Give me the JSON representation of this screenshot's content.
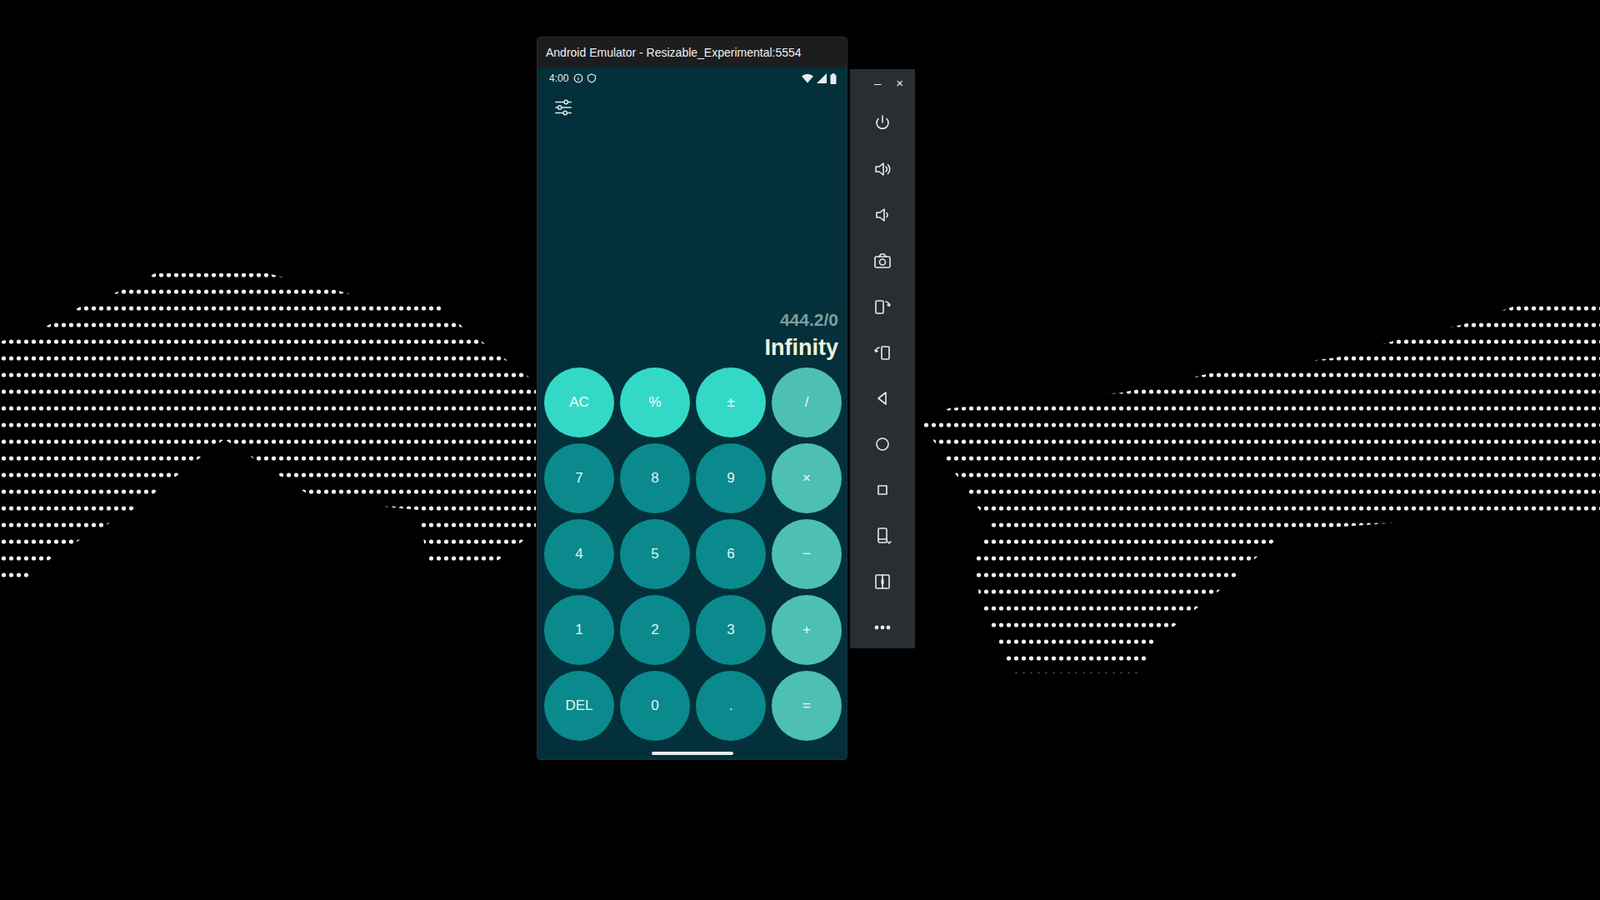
{
  "window": {
    "title": "Android Emulator - Resizable_Experimental:5554"
  },
  "status_bar": {
    "time": "4:00"
  },
  "display": {
    "expression": "444.2/0",
    "result": "Infinity"
  },
  "keys": [
    {
      "label": "AC",
      "kind": "function"
    },
    {
      "label": "%",
      "kind": "function"
    },
    {
      "label": "±",
      "kind": "function"
    },
    {
      "label": "/",
      "kind": "operator"
    },
    {
      "label": "7",
      "kind": "digit"
    },
    {
      "label": "8",
      "kind": "digit"
    },
    {
      "label": "9",
      "kind": "digit"
    },
    {
      "label": "×",
      "kind": "operator"
    },
    {
      "label": "4",
      "kind": "digit"
    },
    {
      "label": "5",
      "kind": "digit"
    },
    {
      "label": "6",
      "kind": "digit"
    },
    {
      "label": "−",
      "kind": "operator"
    },
    {
      "label": "1",
      "kind": "digit"
    },
    {
      "label": "2",
      "kind": "digit"
    },
    {
      "label": "3",
      "kind": "digit"
    },
    {
      "label": "+",
      "kind": "operator"
    },
    {
      "label": "DEL",
      "kind": "digit"
    },
    {
      "label": "0",
      "kind": "digit"
    },
    {
      "label": ".",
      "kind": "digit"
    },
    {
      "label": "=",
      "kind": "operator"
    }
  ],
  "toolbar": {
    "controls": [
      "–",
      "×"
    ]
  }
}
